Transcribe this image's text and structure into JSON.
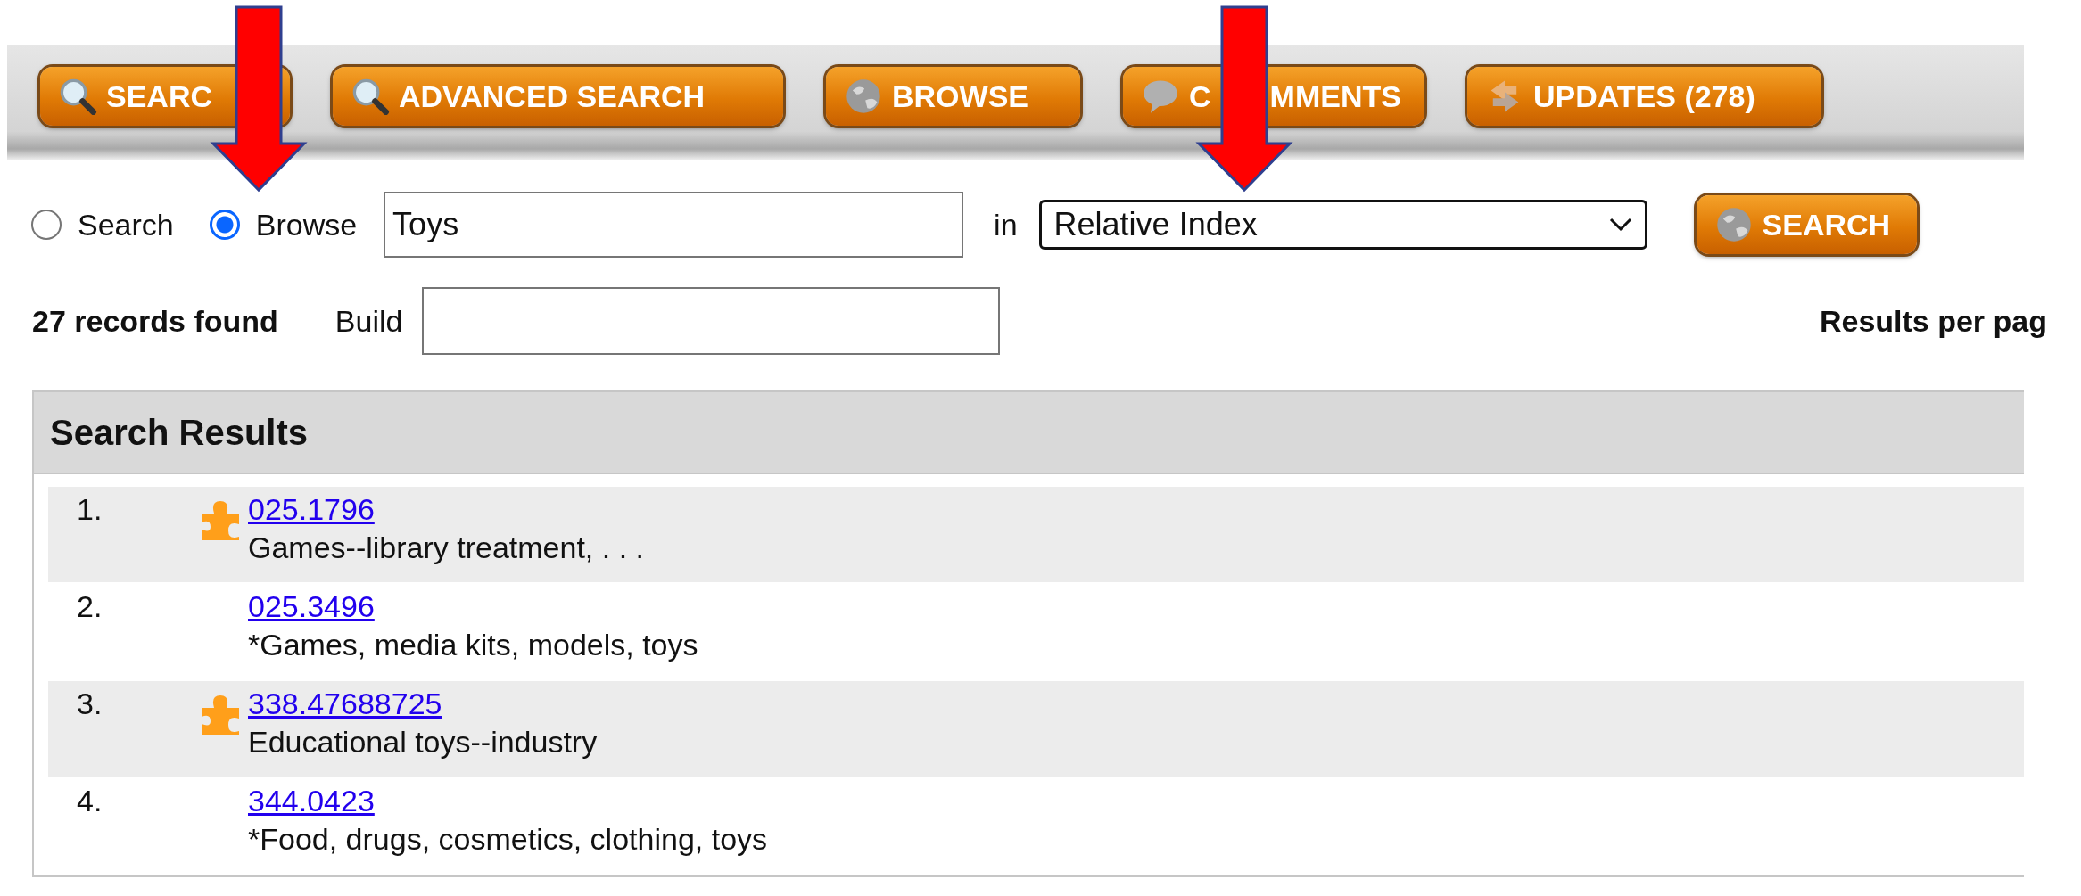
{
  "toolbar": {
    "buttons": [
      {
        "label_parts": [
          "SEARC"
        ],
        "kind": "search"
      },
      {
        "label_parts": [
          "ADVANCED SEARCH"
        ],
        "kind": "search"
      },
      {
        "label_parts": [
          "BROWSE"
        ],
        "kind": "globe"
      },
      {
        "label_parts": [
          "C",
          "MMENTS"
        ],
        "kind": "comment"
      },
      {
        "label_parts": [
          "UPDATES (278)"
        ],
        "kind": "updates"
      }
    ]
  },
  "search_form": {
    "modes": [
      {
        "label": "Search",
        "selected": false
      },
      {
        "label": "Browse",
        "selected": true
      }
    ],
    "query": {
      "value": "Toys"
    },
    "in_label": "in",
    "scope": {
      "value": "Relative Index"
    },
    "submit": {
      "label": "SEARCH"
    }
  },
  "results_bar": {
    "count": "27 records found",
    "build_label": "Build",
    "per_page_label": "Results per pag"
  },
  "results": {
    "title": "Search Results",
    "rows": [
      {
        "number": "1.",
        "has_icon": true,
        "link": "025.1796",
        "description": "Games--library treatment, . . ."
      },
      {
        "number": "2.",
        "has_icon": false,
        "link": "025.3496",
        "description": "*Games, media kits, models, toys"
      },
      {
        "number": "3.",
        "has_icon": true,
        "link": "338.47688725",
        "description": "Educational toys--industry"
      },
      {
        "number": "4.",
        "has_icon": false,
        "link": "344.0423",
        "description": "*Food, drugs, cosmetics, clothing, toys"
      }
    ]
  }
}
